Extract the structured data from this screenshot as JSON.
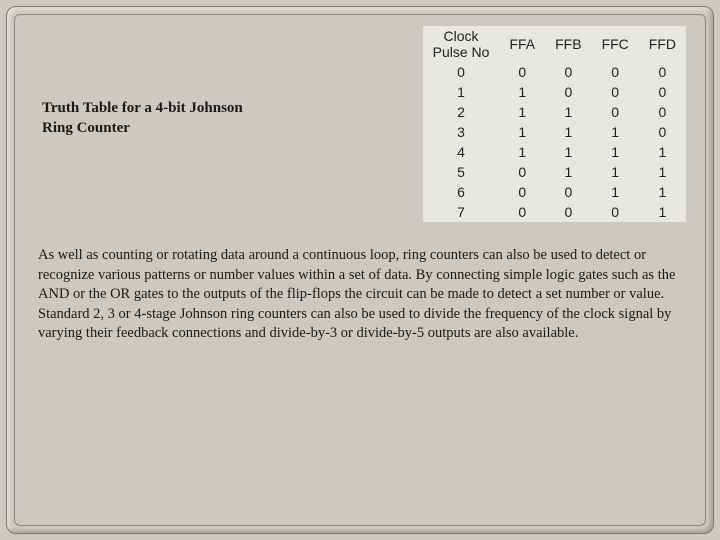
{
  "title_line1": "Truth Table for a 4-bit Johnson",
  "title_line2": "Ring Counter",
  "headers": {
    "clock_l1": "Clock",
    "clock_l2": "Pulse No",
    "ffa": "FFA",
    "ffb": "FFB",
    "ffc": "FFC",
    "ffd": "FFD"
  },
  "rows": [
    {
      "n": "0",
      "a": "0",
      "b": "0",
      "c": "0",
      "d": "0"
    },
    {
      "n": "1",
      "a": "1",
      "b": "0",
      "c": "0",
      "d": "0"
    },
    {
      "n": "2",
      "a": "1",
      "b": "1",
      "c": "0",
      "d": "0"
    },
    {
      "n": "3",
      "a": "1",
      "b": "1",
      "c": "1",
      "d": "0"
    },
    {
      "n": "4",
      "a": "1",
      "b": "1",
      "c": "1",
      "d": "1"
    },
    {
      "n": "5",
      "a": "0",
      "b": "1",
      "c": "1",
      "d": "1"
    },
    {
      "n": "6",
      "a": "0",
      "b": "0",
      "c": "1",
      "d": "1"
    },
    {
      "n": "7",
      "a": "0",
      "b": "0",
      "c": "0",
      "d": "1"
    }
  ],
  "paragraph": "As well as counting or rotating data around a continuous loop, ring counters can also be used to detect or recognize various patterns or number values within a set of data. By connecting simple logic gates such as the AND or the OR gates to the outputs of the flip-flops the circuit can be made to detect a set number or value. Standard 2, 3 or 4-stage Johnson ring counters can also be used to divide the frequency of the clock signal by varying their feedback connections and divide-by-3 or divide-by-5 outputs are also available."
}
